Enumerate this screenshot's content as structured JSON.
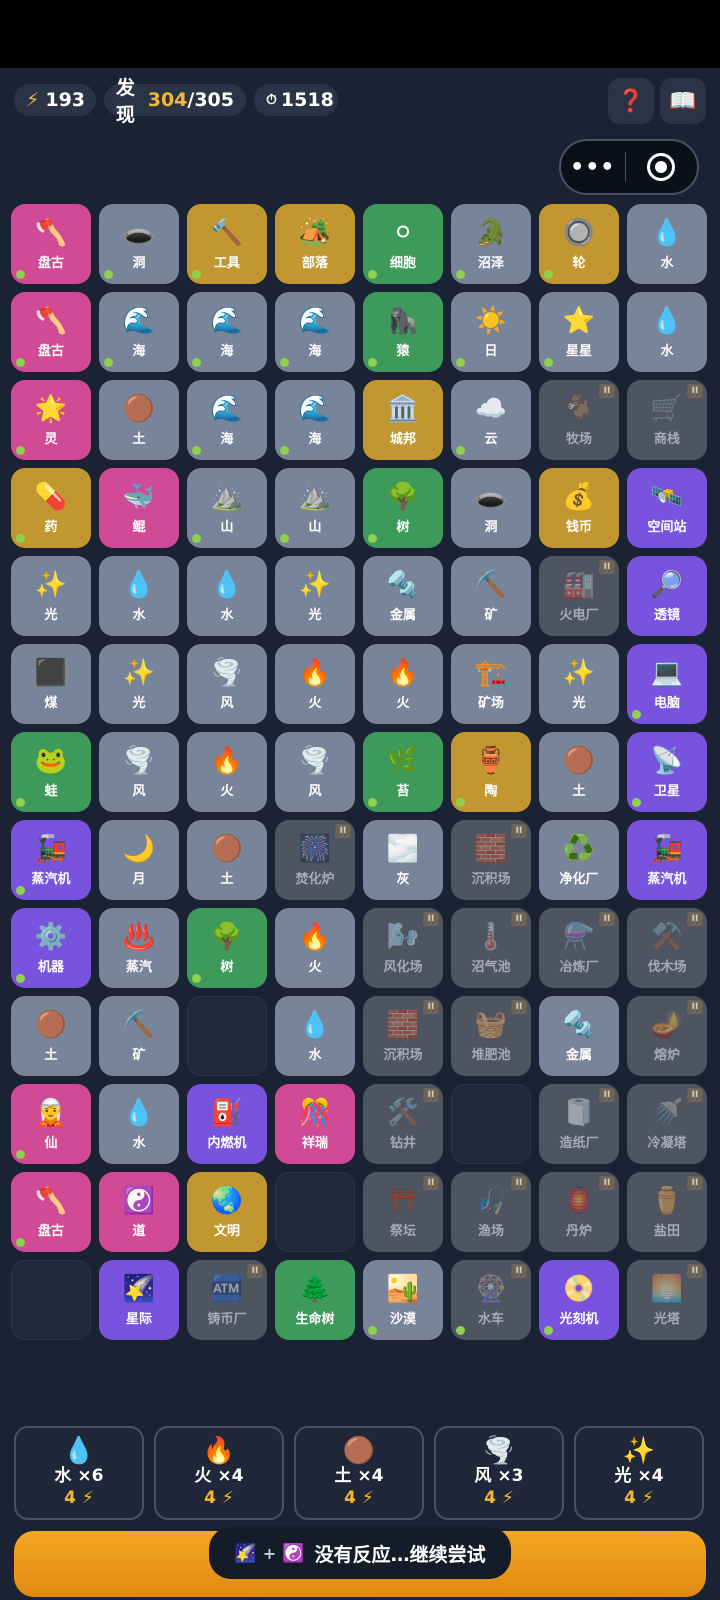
{
  "header": {
    "energy_icon": "⚡",
    "energy": "193",
    "discover_label": "发现",
    "discover_found": "304",
    "discover_total": "/305",
    "timer_icon": "⏱",
    "timer": "1518",
    "help_icon": "❓",
    "book_icon": "📖",
    "menu_dots": "•••"
  },
  "grid": [
    [
      {
        "icon": "🪓",
        "label": "盘古",
        "color": "pink",
        "dot": true,
        "badge": false
      },
      {
        "icon": "🕳️",
        "label": "洞",
        "color": "slate",
        "dot": true,
        "badge": false
      },
      {
        "icon": "🔨",
        "label": "工具",
        "color": "gold",
        "dot": true,
        "badge": false
      },
      {
        "icon": "🏕️",
        "label": "部落",
        "color": "gold",
        "dot": false,
        "badge": false
      },
      {
        "icon": "⚪",
        "label": "细胞",
        "color": "green",
        "dot": true,
        "badge": false
      },
      {
        "icon": "🐊",
        "label": "沼泽",
        "color": "slate",
        "dot": true,
        "badge": false
      },
      {
        "icon": "🔘",
        "label": "轮",
        "color": "gold",
        "dot": true,
        "badge": false
      },
      {
        "icon": "💧",
        "label": "水",
        "color": "slate",
        "dot": false,
        "badge": false
      }
    ],
    [
      {
        "icon": "🪓",
        "label": "盘古",
        "color": "pink",
        "dot": true,
        "badge": false
      },
      {
        "icon": "🌊",
        "label": "海",
        "color": "slate",
        "dot": true,
        "badge": false
      },
      {
        "icon": "🌊",
        "label": "海",
        "color": "slate",
        "dot": true,
        "badge": false
      },
      {
        "icon": "🌊",
        "label": "海",
        "color": "slate",
        "dot": true,
        "badge": false
      },
      {
        "icon": "🦍",
        "label": "猿",
        "color": "green",
        "dot": true,
        "badge": false
      },
      {
        "icon": "☀️",
        "label": "日",
        "color": "slate",
        "dot": true,
        "badge": false
      },
      {
        "icon": "⭐",
        "label": "星星",
        "color": "slate",
        "dot": true,
        "badge": false
      },
      {
        "icon": "💧",
        "label": "水",
        "color": "slate",
        "dot": false,
        "badge": false
      }
    ],
    [
      {
        "icon": "🌟",
        "label": "灵",
        "color": "pink",
        "dot": true,
        "badge": false
      },
      {
        "icon": "🟤",
        "label": "土",
        "color": "slate",
        "dot": false,
        "badge": false
      },
      {
        "icon": "🌊",
        "label": "海",
        "color": "slate",
        "dot": true,
        "badge": false
      },
      {
        "icon": "🌊",
        "label": "海",
        "color": "slate",
        "dot": true,
        "badge": false
      },
      {
        "icon": "🏛️",
        "label": "城邦",
        "color": "gold",
        "dot": false,
        "badge": false
      },
      {
        "icon": "☁️",
        "label": "云",
        "color": "slate",
        "dot": true,
        "badge": false
      },
      {
        "icon": "🐐",
        "label": "牧场",
        "color": "locked",
        "dot": false,
        "badge": true
      },
      {
        "icon": "🛒",
        "label": "商栈",
        "color": "locked",
        "dot": false,
        "badge": true
      }
    ],
    [
      {
        "icon": "💊",
        "label": "药",
        "color": "gold",
        "dot": true,
        "badge": false
      },
      {
        "icon": "🐳",
        "label": "鲲",
        "color": "pink",
        "dot": false,
        "badge": false
      },
      {
        "icon": "⛰️",
        "label": "山",
        "color": "slate",
        "dot": true,
        "badge": false
      },
      {
        "icon": "⛰️",
        "label": "山",
        "color": "slate",
        "dot": true,
        "badge": false
      },
      {
        "icon": "🌳",
        "label": "树",
        "color": "green",
        "dot": true,
        "badge": false
      },
      {
        "icon": "🕳️",
        "label": "洞",
        "color": "slate",
        "dot": false,
        "badge": false
      },
      {
        "icon": "💰",
        "label": "钱币",
        "color": "gold",
        "dot": false,
        "badge": false
      },
      {
        "icon": "🛰️",
        "label": "空间站",
        "color": "purple",
        "dot": false,
        "badge": false
      }
    ],
    [
      {
        "icon": "✨",
        "label": "光",
        "color": "slate",
        "dot": false,
        "badge": false
      },
      {
        "icon": "💧",
        "label": "水",
        "color": "slate",
        "dot": false,
        "badge": false
      },
      {
        "icon": "💧",
        "label": "水",
        "color": "slate",
        "dot": false,
        "badge": false
      },
      {
        "icon": "✨",
        "label": "光",
        "color": "slate",
        "dot": false,
        "badge": false
      },
      {
        "icon": "🔩",
        "label": "金属",
        "color": "slate",
        "dot": false,
        "badge": false
      },
      {
        "icon": "⛏️",
        "label": "矿",
        "color": "slate",
        "dot": false,
        "badge": false
      },
      {
        "icon": "🏭",
        "label": "火电厂",
        "color": "locked",
        "dot": false,
        "badge": true
      },
      {
        "icon": "🔎",
        "label": "透镜",
        "color": "purple",
        "dot": false,
        "badge": false
      }
    ],
    [
      {
        "icon": "⬛",
        "label": "煤",
        "color": "slate",
        "dot": false,
        "badge": false
      },
      {
        "icon": "✨",
        "label": "光",
        "color": "slate",
        "dot": false,
        "badge": false
      },
      {
        "icon": "🌪️",
        "label": "风",
        "color": "slate",
        "dot": false,
        "badge": false
      },
      {
        "icon": "🔥",
        "label": "火",
        "color": "slate",
        "dot": false,
        "badge": false
      },
      {
        "icon": "🔥",
        "label": "火",
        "color": "slate",
        "dot": false,
        "badge": false
      },
      {
        "icon": "🏗️",
        "label": "矿场",
        "color": "slate",
        "dot": false,
        "badge": false
      },
      {
        "icon": "✨",
        "label": "光",
        "color": "slate",
        "dot": false,
        "badge": false
      },
      {
        "icon": "💻",
        "label": "电脑",
        "color": "purple",
        "dot": true,
        "badge": false
      }
    ],
    [
      {
        "icon": "🐸",
        "label": "蛙",
        "color": "green",
        "dot": true,
        "badge": false
      },
      {
        "icon": "🌪️",
        "label": "风",
        "color": "slate",
        "dot": false,
        "badge": false
      },
      {
        "icon": "🔥",
        "label": "火",
        "color": "slate",
        "dot": false,
        "badge": false
      },
      {
        "icon": "🌪️",
        "label": "风",
        "color": "slate",
        "dot": false,
        "badge": false
      },
      {
        "icon": "🌿",
        "label": "苔",
        "color": "green",
        "dot": true,
        "badge": false
      },
      {
        "icon": "🏺",
        "label": "陶",
        "color": "gold",
        "dot": true,
        "badge": false
      },
      {
        "icon": "🟤",
        "label": "土",
        "color": "slate",
        "dot": false,
        "badge": false
      },
      {
        "icon": "📡",
        "label": "卫星",
        "color": "purple",
        "dot": true,
        "badge": false
      }
    ],
    [
      {
        "icon": "🚂",
        "label": "蒸汽机",
        "color": "purple",
        "dot": true,
        "badge": false
      },
      {
        "icon": "🌙",
        "label": "月",
        "color": "slate",
        "dot": false,
        "badge": false
      },
      {
        "icon": "🟤",
        "label": "土",
        "color": "slate",
        "dot": false,
        "badge": false
      },
      {
        "icon": "🎆",
        "label": "焚化炉",
        "color": "locked",
        "dot": false,
        "badge": true
      },
      {
        "icon": "🌫️",
        "label": "灰",
        "color": "slate",
        "dot": false,
        "badge": false
      },
      {
        "icon": "🧱",
        "label": "沉积场",
        "color": "locked",
        "dot": false,
        "badge": true
      },
      {
        "icon": "♻️",
        "label": "净化厂",
        "color": "slate",
        "dot": false,
        "badge": false
      },
      {
        "icon": "🚂",
        "label": "蒸汽机",
        "color": "purple",
        "dot": false,
        "badge": false
      }
    ],
    [
      {
        "icon": "⚙️",
        "label": "机器",
        "color": "purple",
        "dot": true,
        "badge": false
      },
      {
        "icon": "♨️",
        "label": "蒸汽",
        "color": "slate",
        "dot": false,
        "badge": false
      },
      {
        "icon": "🌳",
        "label": "树",
        "color": "green",
        "dot": true,
        "badge": false
      },
      {
        "icon": "🔥",
        "label": "火",
        "color": "slate",
        "dot": false,
        "badge": false
      },
      {
        "icon": "🌬️",
        "label": "风化场",
        "color": "locked",
        "dot": false,
        "badge": true
      },
      {
        "icon": "🌡️",
        "label": "沼气池",
        "color": "locked",
        "dot": false,
        "badge": true
      },
      {
        "icon": "⚗️",
        "label": "冶炼厂",
        "color": "locked",
        "dot": false,
        "badge": true
      },
      {
        "icon": "⚒️",
        "label": "伐木场",
        "color": "locked",
        "dot": false,
        "badge": true
      }
    ],
    [
      {
        "icon": "🟤",
        "label": "土",
        "color": "slate",
        "dot": false,
        "badge": false
      },
      {
        "icon": "⛏️",
        "label": "矿",
        "color": "slate",
        "dot": false,
        "badge": false
      },
      {
        "icon": "",
        "label": "",
        "color": "empty",
        "dot": false,
        "badge": false
      },
      {
        "icon": "💧",
        "label": "水",
        "color": "slate",
        "dot": false,
        "badge": false
      },
      {
        "icon": "🧱",
        "label": "沉积场",
        "color": "locked",
        "dot": false,
        "badge": true
      },
      {
        "icon": "🧺",
        "label": "堆肥池",
        "color": "locked",
        "dot": false,
        "badge": true
      },
      {
        "icon": "🔩",
        "label": "金属",
        "color": "slate",
        "dot": false,
        "badge": false
      },
      {
        "icon": "🪔",
        "label": "熔炉",
        "color": "locked",
        "dot": false,
        "badge": true
      }
    ],
    [
      {
        "icon": "🧝",
        "label": "仙",
        "color": "pink",
        "dot": true,
        "badge": false
      },
      {
        "icon": "💧",
        "label": "水",
        "color": "slate",
        "dot": false,
        "badge": false
      },
      {
        "icon": "⛽",
        "label": "内燃机",
        "color": "purple",
        "dot": false,
        "badge": false
      },
      {
        "icon": "🎊",
        "label": "祥瑞",
        "color": "pink",
        "dot": false,
        "badge": false
      },
      {
        "icon": "🛠️",
        "label": "钻井",
        "color": "locked",
        "dot": false,
        "badge": true
      },
      {
        "icon": "",
        "label": "",
        "color": "empty",
        "dot": false,
        "badge": false
      },
      {
        "icon": "🧻",
        "label": "造纸厂",
        "color": "locked",
        "dot": false,
        "badge": true
      },
      {
        "icon": "🚿",
        "label": "冷凝塔",
        "color": "locked",
        "dot": false,
        "badge": true
      }
    ],
    [
      {
        "icon": "🪓",
        "label": "盘古",
        "color": "pink",
        "dot": true,
        "badge": false
      },
      {
        "icon": "☯️",
        "label": "道",
        "color": "pink",
        "dot": false,
        "badge": false
      },
      {
        "icon": "🌏",
        "label": "文明",
        "color": "gold",
        "dot": false,
        "badge": false
      },
      {
        "icon": "",
        "label": "",
        "color": "empty",
        "dot": false,
        "badge": false
      },
      {
        "icon": "⛩️",
        "label": "祭坛",
        "color": "locked",
        "dot": false,
        "badge": true
      },
      {
        "icon": "🎣",
        "label": "渔场",
        "color": "locked",
        "dot": false,
        "badge": true
      },
      {
        "icon": "🏮",
        "label": "丹炉",
        "color": "locked",
        "dot": false,
        "badge": true
      },
      {
        "icon": "⚱️",
        "label": "盐田",
        "color": "locked",
        "dot": false,
        "badge": true
      }
    ],
    [
      {
        "icon": "",
        "label": "",
        "color": "empty",
        "dot": false,
        "badge": false
      },
      {
        "icon": "🌠",
        "label": "星际",
        "color": "purple",
        "dot": false,
        "badge": false
      },
      {
        "icon": "🏧",
        "label": "铸币厂",
        "color": "locked",
        "dot": false,
        "badge": true
      },
      {
        "icon": "🌲",
        "label": "生命树",
        "color": "green",
        "dot": false,
        "badge": false
      },
      {
        "icon": "🏜️",
        "label": "沙漠",
        "color": "slate",
        "dot": true,
        "badge": false
      },
      {
        "icon": "🎡",
        "label": "水车",
        "color": "locked",
        "dot": true,
        "badge": true
      },
      {
        "icon": "📀",
        "label": "光刻机",
        "color": "purple",
        "dot": true,
        "badge": false
      },
      {
        "icon": "🌅",
        "label": "光塔",
        "color": "locked",
        "dot": false,
        "badge": true
      }
    ]
  ],
  "resources": [
    {
      "icon": "💧",
      "name": "水 ×6",
      "cost": "4 ⚡"
    },
    {
      "icon": "🔥",
      "name": "火 ×4",
      "cost": "4 ⚡"
    },
    {
      "icon": "🟤",
      "name": "土 ×4",
      "cost": "4 ⚡"
    },
    {
      "icon": "🌪️",
      "name": "风 ×3",
      "cost": "4 ⚡"
    },
    {
      "icon": "✨",
      "name": "光 ×4",
      "cost": "4 ⚡"
    }
  ],
  "toast": {
    "left_icon": "🌠",
    "plus": "+",
    "right_icon": "☯️",
    "message": "没有反应…继续尝试"
  },
  "colors": {
    "background": "#1a2233",
    "accent": "#f5b731",
    "cta": "#f5a623"
  }
}
